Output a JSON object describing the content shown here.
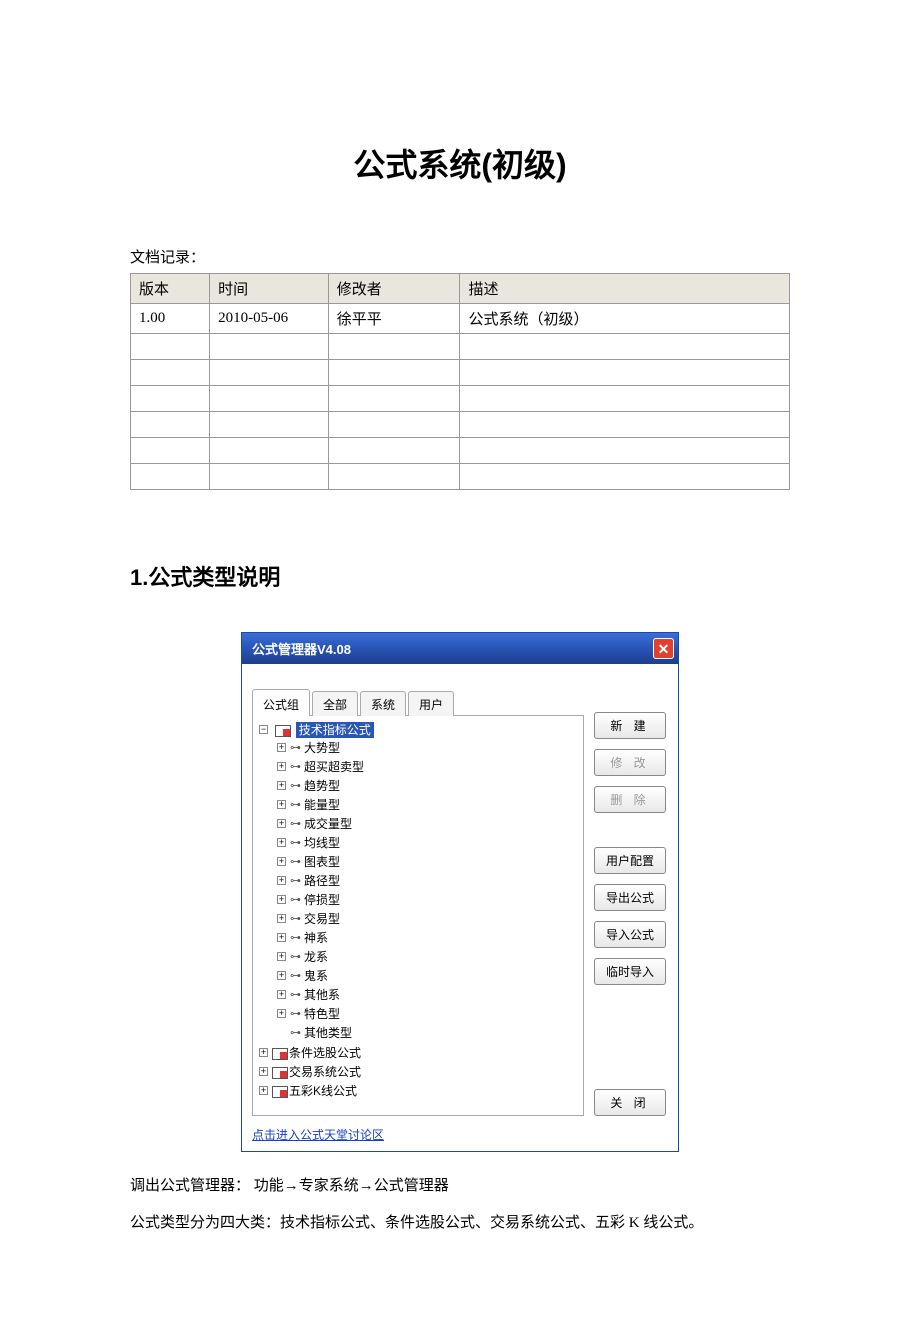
{
  "title": "公式系统(初级)",
  "record_label": "文档记录：",
  "table": {
    "headers": [
      "版本",
      "时间",
      "修改者",
      "描述"
    ],
    "rows": [
      [
        "1.00",
        "2010-05-06",
        "徐平平",
        "公式系统（初级）"
      ]
    ],
    "blank_rows": 6
  },
  "section1": "1.公式类型说明",
  "dlg": {
    "title": "公式管理器V4.08",
    "tabs": [
      "公式组",
      "全部",
      "系统",
      "用户"
    ],
    "active_tab": 0,
    "tree": {
      "root_label": "技术指标公式",
      "children": [
        "大势型",
        "超买超卖型",
        "趋势型",
        "能量型",
        "成交量型",
        "均线型",
        "图表型",
        "路径型",
        "停损型",
        "交易型",
        "神系",
        "龙系",
        "鬼系",
        "其他系",
        "特色型",
        "其他类型"
      ],
      "siblings": [
        "条件选股公式",
        "交易系统公式",
        "五彩K线公式"
      ]
    },
    "buttons": {
      "new": "新  建",
      "edit": "修  改",
      "delete": "删  除",
      "user_cfg": "用户配置",
      "export": "导出公式",
      "import": "导入公式",
      "temp_import": "临时导入",
      "close": "关  闭"
    },
    "footer_link": "点击进入公式天堂讨论区"
  },
  "para1_pre": "调出公式管理器：  功能",
  "para1_a": "专家系统",
  "para1_b": "公式管理器",
  "para2": "公式类型分为四大类：技术指标公式、条件选股公式、交易系统公式、五彩 K 线公式。",
  "arrow": "→"
}
